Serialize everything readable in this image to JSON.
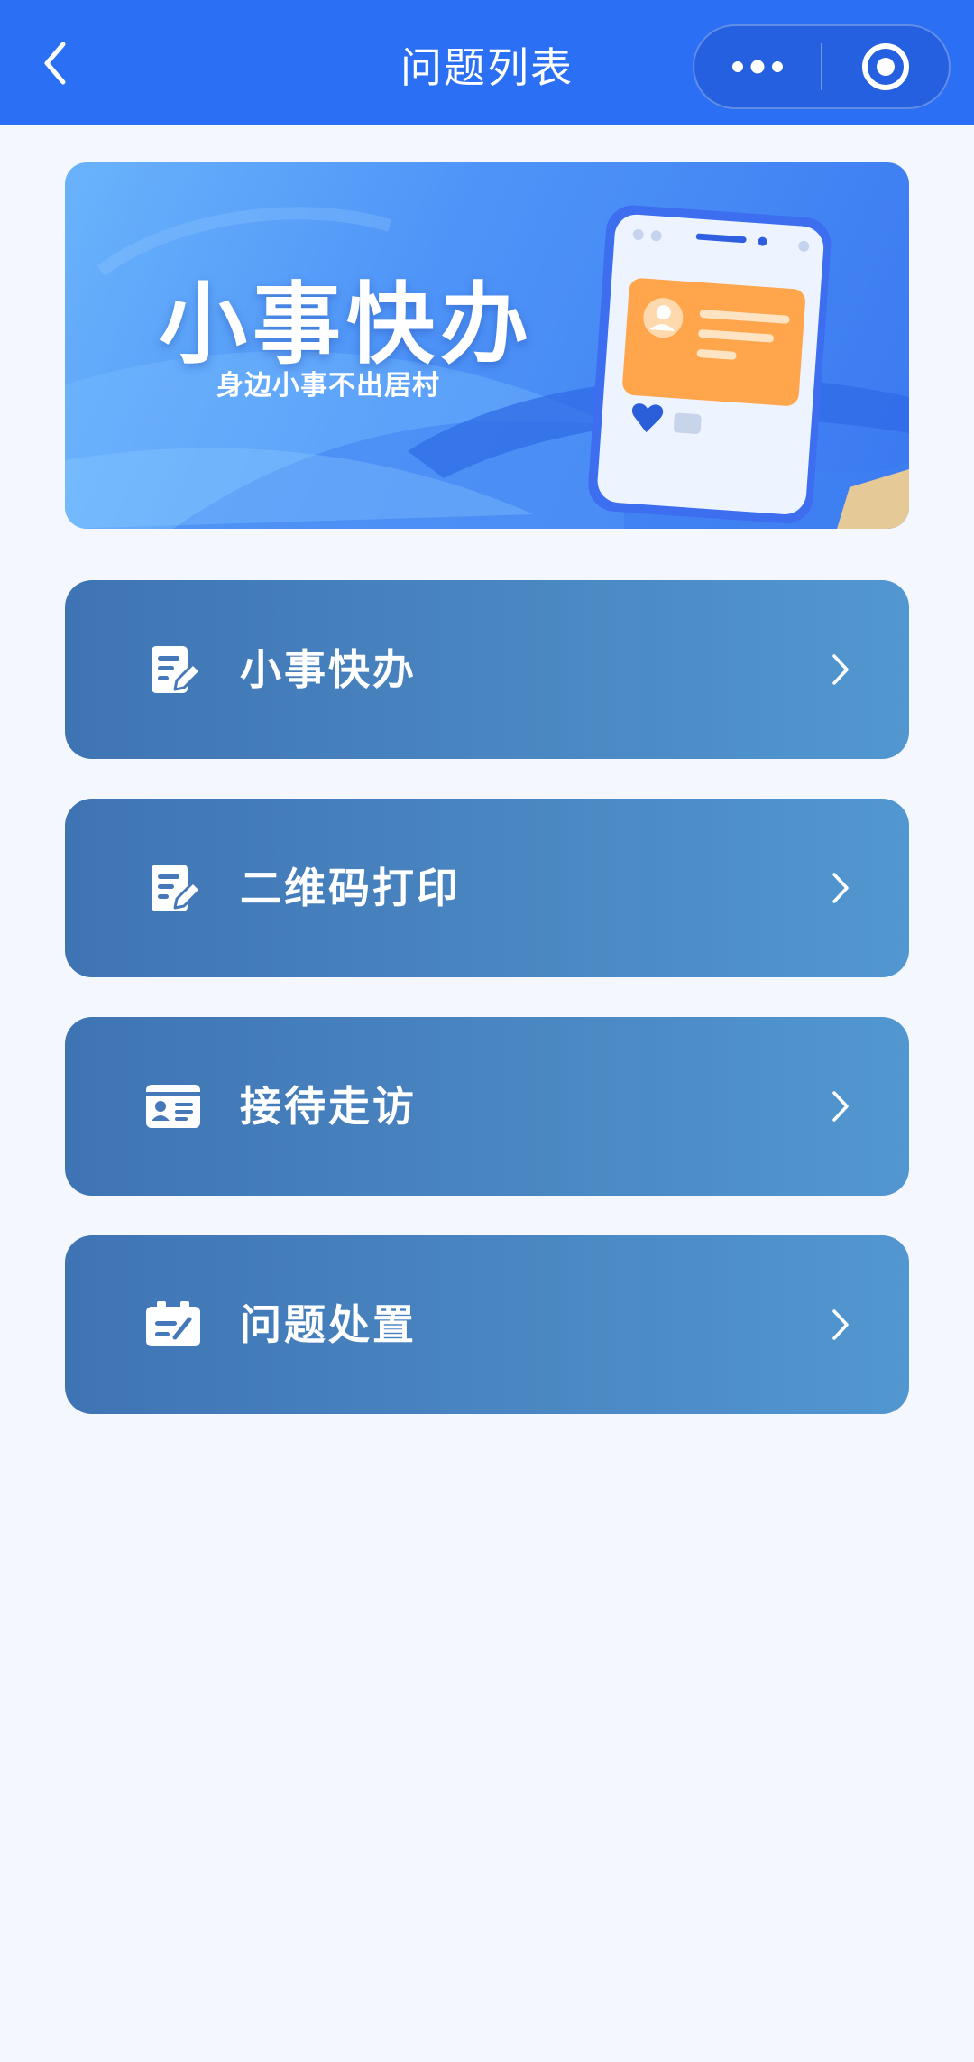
{
  "navbar": {
    "title": "问题列表",
    "back_icon": "chevron-left-icon",
    "more_icon": "more-dots-icon",
    "close_icon": "target-circle-icon",
    "background": "#2a6ff4"
  },
  "banner": {
    "title": "小事快办",
    "subtitle": "身边小事不出居村"
  },
  "menu": {
    "items": [
      {
        "label": "小事快办",
        "icon": "edit-note-icon"
      },
      {
        "label": "二维码打印",
        "icon": "edit-note-icon"
      },
      {
        "label": "接待走访",
        "icon": "id-card-icon"
      },
      {
        "label": "问题处置",
        "icon": "clipboard-icon"
      }
    ],
    "arrow_icon": "chevron-right-icon",
    "card_color": "#4a87c2"
  }
}
